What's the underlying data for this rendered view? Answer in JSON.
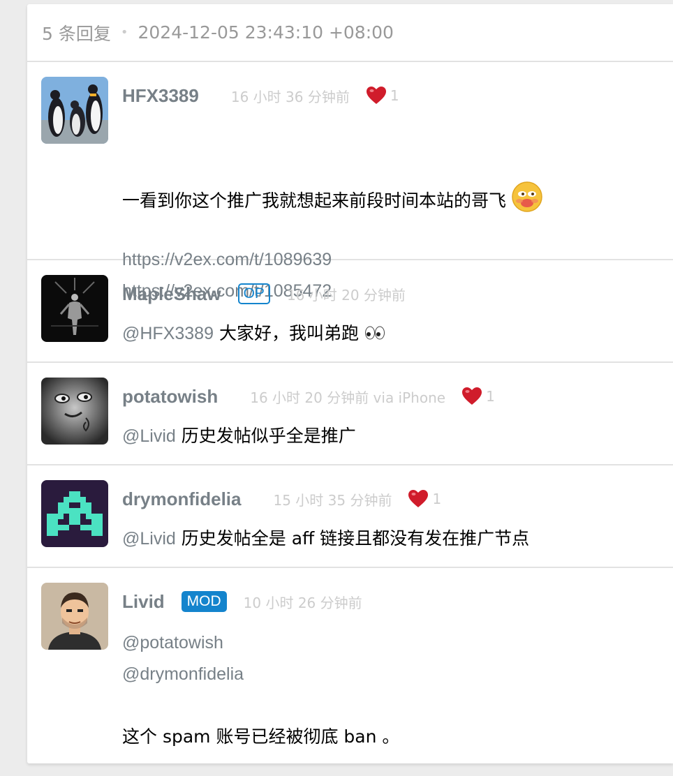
{
  "header": {
    "reply_count": "5 条回复",
    "separator": "•",
    "datetime": "2024-12-05 23:43:10 +08:00"
  },
  "replies": [
    {
      "avatar_icon": "penguins-avatar",
      "username": "HFX3389",
      "ago": "16 小时 36 分钟前",
      "thanks": "1",
      "line1": "一看到你这个推广我就想起来前段时间本站的哥飞",
      "emoji_icon": "smirking-face-emoji",
      "link1": "https://v2ex.com/t/1089639",
      "link2": "https://v2ex.com/t/1085472"
    },
    {
      "avatar_icon": "dark-figure-avatar",
      "username": "MapleShaw",
      "badge": "OP",
      "ago": "16 小时 20 分钟前",
      "mention": "@HFX3389",
      "text": " 大家好，我叫弟跑",
      "emoji_icon": "eyes-emoji"
    },
    {
      "avatar_icon": "gray-face-avatar",
      "username": "potatowish",
      "ago": "16 小时 20 分钟前 via iPhone",
      "thanks": "1",
      "mention": "@Livid",
      "text": " 历史发帖似乎全是推广"
    },
    {
      "avatar_icon": "pixel-invader-avatar",
      "username": "drymonfidelia",
      "ago": "15 小时 35 分钟前",
      "thanks": "1",
      "mention": "@Livid",
      "text": " 历史发帖全是 aff 链接且都没有发在推广节点"
    },
    {
      "avatar_icon": "cartoon-man-avatar",
      "username": "Livid",
      "badge": "MOD",
      "ago": "10 小时 26 分钟前",
      "mention1": "@potatowish",
      "mention2": "@drymonfidelia",
      "text": "这个 spam 账号已经被彻底 ban 。"
    }
  ],
  "colors": {
    "username": "#778087",
    "badge": "#1484cd",
    "muted": "#cccccc",
    "heart": "#d01c2b"
  }
}
